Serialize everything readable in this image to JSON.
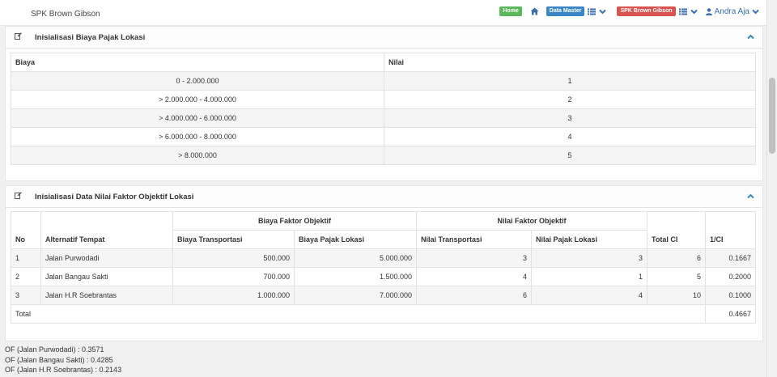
{
  "navbar": {
    "brand": "SPK Brown Gibson",
    "home_label": "Home",
    "data_master_label": "Data Master",
    "spk_label": "SPK Brown Gibson",
    "user_name": "Andra Aja",
    "colors": {
      "home": "#5cb85c",
      "data_master": "#3a87c8",
      "spk": "#d9534f",
      "icon": "#3a6fb0"
    }
  },
  "widget1": {
    "title": "Inisialisasi Biaya Pajak Lokasi",
    "headers": {
      "biaya": "Biaya",
      "nilai": "Nilai"
    },
    "rows": [
      {
        "biaya": "0 - 2.000.000",
        "nilai": "1"
      },
      {
        "biaya": "> 2.000.000 - 4.000.000",
        "nilai": "2"
      },
      {
        "biaya": "> 4.000.000 - 6.000.000",
        "nilai": "3"
      },
      {
        "biaya": "> 6.000.000 - 8.000.000",
        "nilai": "4"
      },
      {
        "biaya": "> 8.000.000",
        "nilai": "5"
      }
    ]
  },
  "widget2": {
    "title": "Inisialisasi Data Nilai Faktor Objektif Lokasi",
    "headers": {
      "no": "No",
      "alternatif": "Alternatif Tempat",
      "biaya_group": "Biaya Faktor Objektif",
      "nilai_group": "Nilai Faktor Objektif",
      "biaya_transport": "Biaya Transportasi",
      "biaya_pajak": "Biaya Pajak Lokasi",
      "nilai_transport": "Nilai Transportasi",
      "nilai_pajak": "Nilai Pajak Lokasi",
      "total_ci": "Total CI",
      "inv_ci": "1/CI"
    },
    "rows": [
      {
        "no": "1",
        "alt": "Jalan Purwodadi",
        "bt": "500.000",
        "bp": "5.000.000",
        "nt": "3",
        "np": "3",
        "ci": "6",
        "inv": "0.1667"
      },
      {
        "no": "2",
        "alt": "Jalan Bangau Sakti",
        "bt": "700.000",
        "bp": "1.500.000",
        "nt": "4",
        "np": "1",
        "ci": "5",
        "inv": "0.2000"
      },
      {
        "no": "3",
        "alt": "Jalan H.R Soebrantas",
        "bt": "1.000.000",
        "bp": "7.000.000",
        "nt": "6",
        "np": "4",
        "ci": "10",
        "inv": "0.1000"
      }
    ],
    "total_label": "Total",
    "total_value": "0.4667"
  },
  "of_results": [
    "OF (Jalan Purwodadi) : 0.3571",
    "OF (Jalan Bangau Sakti) : 0.4285",
    "OF (Jalan H.R Soebrantas) : 0.2143"
  ]
}
